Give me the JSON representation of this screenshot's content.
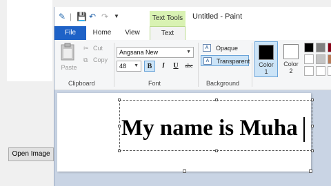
{
  "background_app": {
    "open_image_button": "Open Image"
  },
  "paint": {
    "title": "Untitled - Paint",
    "context_tab_header": "Text Tools",
    "tabs": [
      "File",
      "Home",
      "View",
      "Text"
    ],
    "clipboard": {
      "paste": "Paste",
      "cut": "Cut",
      "copy": "Copy",
      "label": "Clipboard"
    },
    "font": {
      "family": "Angsana New",
      "size": "48",
      "bold": "B",
      "italic": "I",
      "underline": "U",
      "strikethrough": "abc",
      "label": "Font"
    },
    "background": {
      "opaque": "Opaque",
      "transparent": "Transparent",
      "label": "Background"
    },
    "colors": {
      "color1_label": "Color",
      "color1_num": "1",
      "color2_label": "Color",
      "color2_num": "2",
      "color1": "#000000",
      "color2": "#ffffff"
    },
    "palette": [
      "#000000",
      "#7f7f7f",
      "#880015",
      "#ffffff",
      "#c3c3c3",
      "#b97a57",
      "#ffffff",
      "#ffffff",
      "#ffffff"
    ],
    "canvas_text": "My name is Muha"
  },
  "colors": {
    "file_tab": "#1e62c7",
    "texttools": "#d9f2b3",
    "selection": "#cce4f7",
    "canvas_bg": "#c9d4e4"
  }
}
